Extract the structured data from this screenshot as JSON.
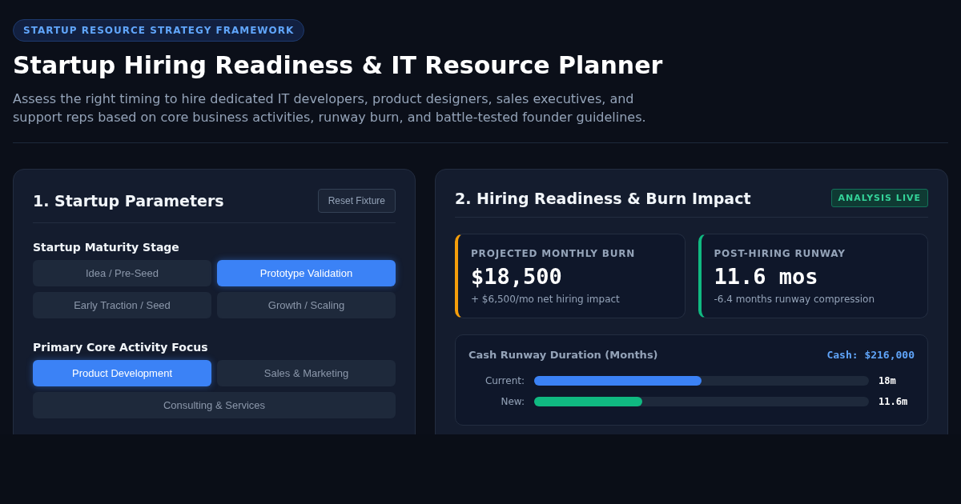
{
  "header": {
    "badge": "STARTUP RESOURCE STRATEGY FRAMEWORK",
    "title": "Startup Hiring Readiness & IT Resource Planner",
    "description": "Assess the right timing to hire dedicated IT developers, product designers, sales executives, and support reps based on core business activities, runway burn, and battle-tested founder guidelines."
  },
  "parameters": {
    "title": "1. Startup Parameters",
    "reset_button": "Reset Fixture",
    "groups": [
      {
        "label": "Startup Maturity Stage",
        "options": [
          {
            "label": "Idea / Pre-Seed",
            "selected": false
          },
          {
            "label": "Prototype Validation",
            "selected": true
          },
          {
            "label": "Early Traction / Seed",
            "selected": false
          },
          {
            "label": "Growth / Scaling",
            "selected": false
          }
        ]
      },
      {
        "label": "Primary Core Activity Focus",
        "options": [
          {
            "label": "Product Development",
            "selected": true
          },
          {
            "label": "Sales & Marketing",
            "selected": false
          },
          {
            "label": "Consulting & Services",
            "selected": false
          }
        ]
      }
    ]
  },
  "impact": {
    "title": "2. Hiring Readiness & Burn Impact",
    "status_badge": "ANALYSIS LIVE",
    "metrics": [
      {
        "label": "PROJECTED MONTHLY BURN",
        "value": "$18,500",
        "note": "+ $6,500/mo net hiring impact",
        "color": "#f59e0b"
      },
      {
        "label": "POST-HIRING RUNWAY",
        "value": "11.6 mos",
        "note": "-6.4 months runway compression",
        "color": "#10b981"
      }
    ],
    "runway": {
      "title": "Cash Runway Duration (Months)",
      "cash": "Cash: $216,000",
      "bars": [
        {
          "label": "Current:",
          "level": 0.5,
          "reading": "18m",
          "color": "#3b82f6"
        },
        {
          "label": "New:",
          "level": 0.323,
          "reading": "11.6m",
          "color": "#10b981"
        }
      ]
    }
  }
}
